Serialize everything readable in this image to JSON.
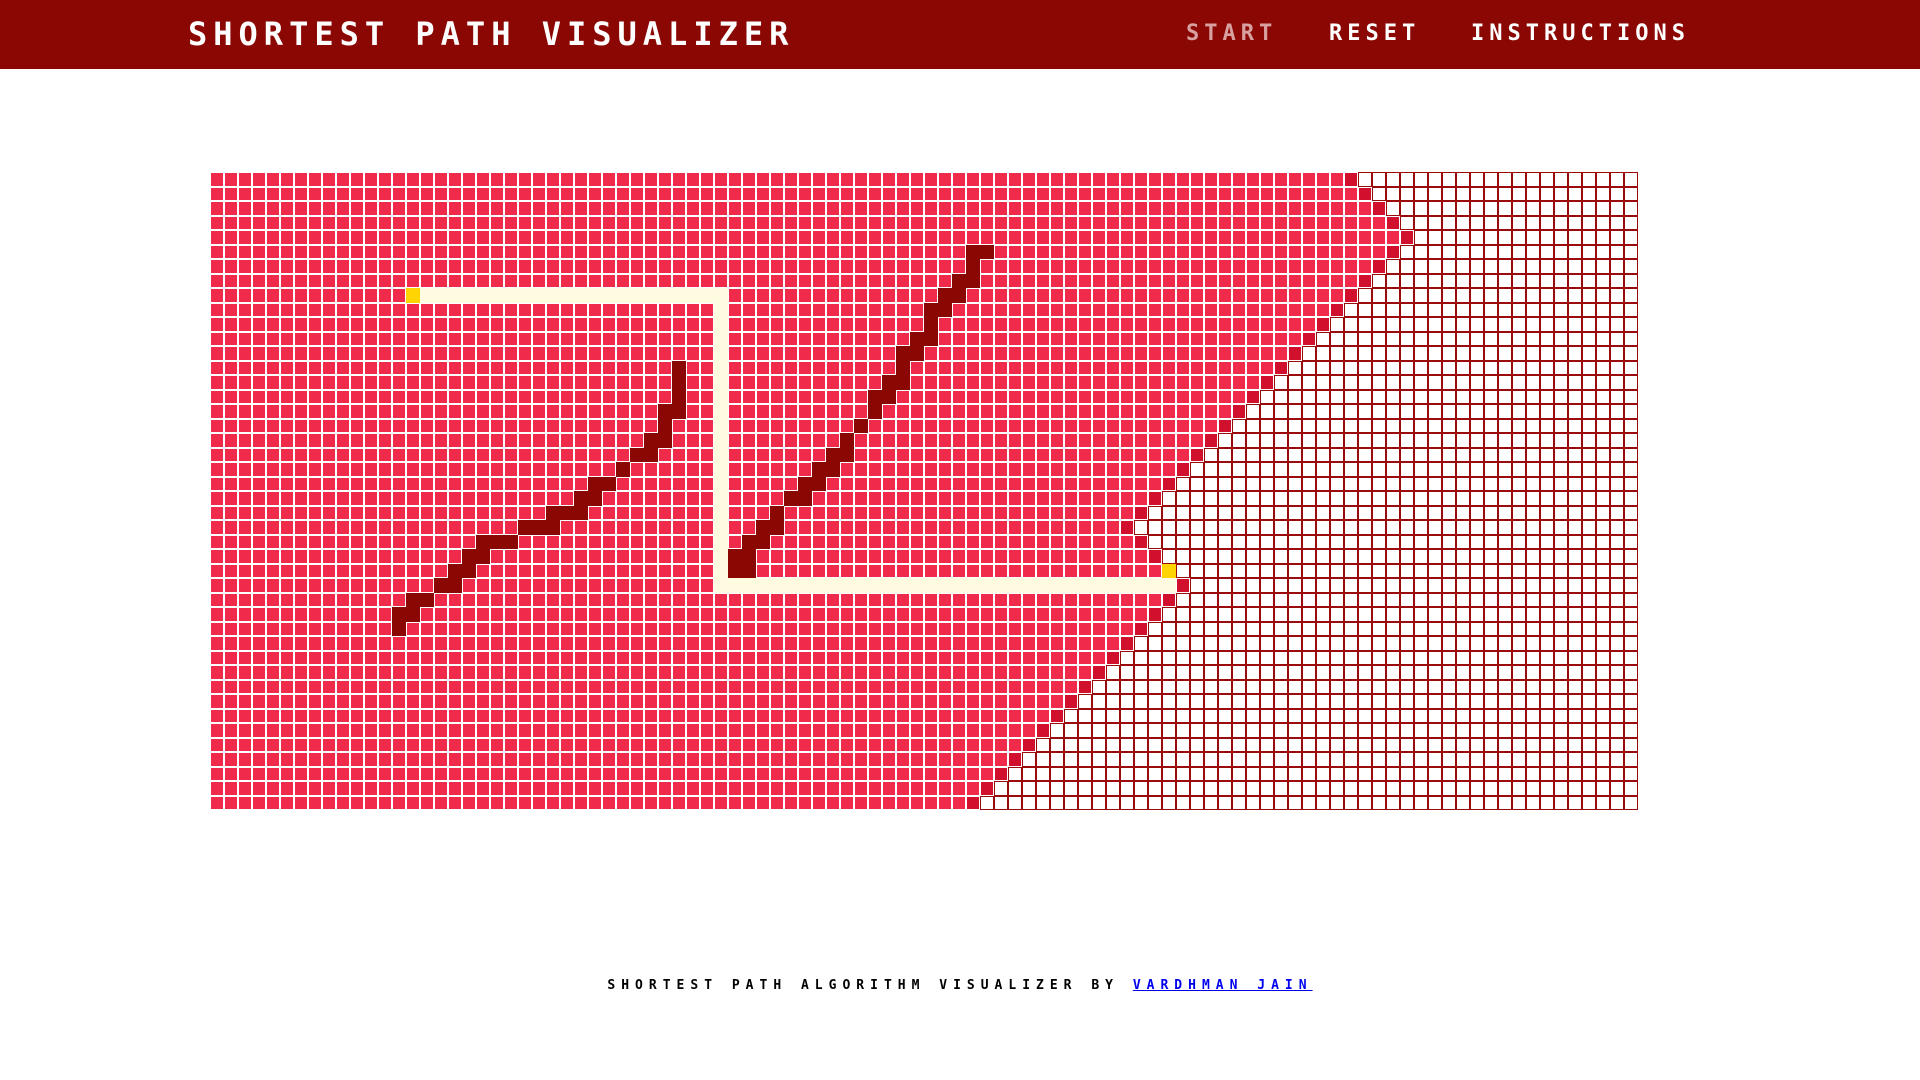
{
  "navbar": {
    "brand": "SHORTEST PATH VISUALIZER",
    "items": [
      {
        "label": "START",
        "state": "disabled"
      },
      {
        "label": "RESET"
      },
      {
        "label": "INSTRUCTIONS"
      }
    ]
  },
  "grid": {
    "rows": 44,
    "cols": 102,
    "start": [
      8,
      14
    ],
    "target": [
      27,
      68
    ],
    "walls": [
      [
        13,
        33
      ],
      [
        14,
        33
      ],
      [
        15,
        33
      ],
      [
        16,
        32
      ],
      [
        16,
        33
      ],
      [
        17,
        32
      ],
      [
        18,
        31
      ],
      [
        18,
        32
      ],
      [
        19,
        30
      ],
      [
        19,
        31
      ],
      [
        20,
        29
      ],
      [
        21,
        27
      ],
      [
        21,
        28
      ],
      [
        22,
        26
      ],
      [
        22,
        27
      ],
      [
        23,
        24
      ],
      [
        23,
        25
      ],
      [
        23,
        26
      ],
      [
        24,
        22
      ],
      [
        24,
        23
      ],
      [
        24,
        24
      ],
      [
        25,
        19
      ],
      [
        25,
        20
      ],
      [
        25,
        21
      ],
      [
        26,
        18
      ],
      [
        26,
        19
      ],
      [
        27,
        17
      ],
      [
        27,
        18
      ],
      [
        28,
        16
      ],
      [
        28,
        17
      ],
      [
        29,
        14
      ],
      [
        29,
        15
      ],
      [
        30,
        13
      ],
      [
        30,
        14
      ],
      [
        31,
        13
      ],
      [
        5,
        54
      ],
      [
        5,
        55
      ],
      [
        6,
        54
      ],
      [
        7,
        53
      ],
      [
        7,
        54
      ],
      [
        8,
        52
      ],
      [
        8,
        53
      ],
      [
        9,
        51
      ],
      [
        9,
        52
      ],
      [
        10,
        51
      ],
      [
        11,
        50
      ],
      [
        11,
        51
      ],
      [
        12,
        49
      ],
      [
        12,
        50
      ],
      [
        13,
        49
      ],
      [
        14,
        48
      ],
      [
        14,
        49
      ],
      [
        15,
        47
      ],
      [
        15,
        48
      ],
      [
        16,
        47
      ],
      [
        17,
        46
      ],
      [
        18,
        45
      ],
      [
        19,
        44
      ],
      [
        19,
        45
      ],
      [
        20,
        43
      ],
      [
        20,
        44
      ],
      [
        21,
        42
      ],
      [
        21,
        43
      ],
      [
        22,
        41
      ],
      [
        22,
        42
      ],
      [
        23,
        40
      ],
      [
        24,
        39
      ],
      [
        24,
        40
      ],
      [
        25,
        38
      ],
      [
        25,
        39
      ],
      [
        26,
        37
      ],
      [
        26,
        38
      ],
      [
        27,
        37
      ],
      [
        27,
        38
      ]
    ],
    "path": [
      [
        8,
        15
      ],
      [
        8,
        16
      ],
      [
        8,
        17
      ],
      [
        8,
        18
      ],
      [
        8,
        19
      ],
      [
        8,
        20
      ],
      [
        8,
        21
      ],
      [
        8,
        22
      ],
      [
        8,
        23
      ],
      [
        8,
        24
      ],
      [
        8,
        25
      ],
      [
        8,
        26
      ],
      [
        8,
        27
      ],
      [
        8,
        28
      ],
      [
        8,
        29
      ],
      [
        8,
        30
      ],
      [
        8,
        31
      ],
      [
        8,
        32
      ],
      [
        8,
        33
      ],
      [
        8,
        34
      ],
      [
        8,
        35
      ],
      [
        8,
        36
      ],
      [
        9,
        36
      ],
      [
        10,
        36
      ],
      [
        11,
        36
      ],
      [
        12,
        36
      ],
      [
        13,
        36
      ],
      [
        14,
        36
      ],
      [
        15,
        36
      ],
      [
        16,
        36
      ],
      [
        17,
        36
      ],
      [
        18,
        36
      ],
      [
        19,
        36
      ],
      [
        20,
        36
      ],
      [
        21,
        36
      ],
      [
        22,
        36
      ],
      [
        23,
        36
      ],
      [
        24,
        36
      ],
      [
        25,
        36
      ],
      [
        26,
        36
      ],
      [
        27,
        36
      ],
      [
        28,
        36
      ],
      [
        28,
        37
      ],
      [
        28,
        38
      ],
      [
        28,
        39
      ],
      [
        28,
        40
      ],
      [
        28,
        41
      ],
      [
        28,
        42
      ],
      [
        28,
        43
      ],
      [
        28,
        44
      ],
      [
        28,
        45
      ],
      [
        28,
        46
      ],
      [
        28,
        47
      ],
      [
        28,
        48
      ],
      [
        28,
        49
      ],
      [
        28,
        50
      ],
      [
        28,
        51
      ],
      [
        28,
        52
      ],
      [
        28,
        53
      ],
      [
        28,
        54
      ],
      [
        28,
        55
      ],
      [
        28,
        56
      ],
      [
        28,
        57
      ],
      [
        28,
        58
      ],
      [
        28,
        59
      ],
      [
        28,
        60
      ],
      [
        28,
        61
      ],
      [
        28,
        62
      ],
      [
        28,
        63
      ],
      [
        28,
        64
      ],
      [
        28,
        65
      ],
      [
        28,
        66
      ],
      [
        28,
        67
      ],
      [
        28,
        68
      ]
    ],
    "colors": {
      "visited": "#f02a4a",
      "frontier": "#d0102c",
      "wall": "#8b0704",
      "path": "#fffbe0",
      "endpoint": "#ffd400",
      "unvisited": "#ffffff"
    }
  },
  "footer": {
    "text": "SHORTEST PATH ALGORITHM VISUALIZER BY",
    "author": "VARDHMAN JAIN"
  }
}
